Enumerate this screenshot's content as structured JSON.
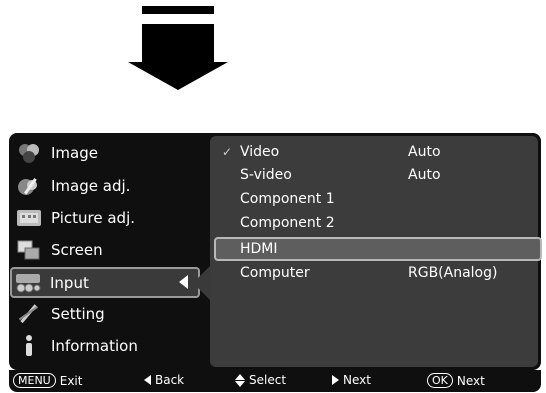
{
  "sidebar": {
    "items": [
      {
        "label": "Image",
        "icon": "image-icon"
      },
      {
        "label": "Image adj.",
        "icon": "image-adjust-icon"
      },
      {
        "label": "Picture adj.",
        "icon": "picture-adjust-icon"
      },
      {
        "label": "Screen",
        "icon": "screen-icon"
      },
      {
        "label": "Input",
        "icon": "input-icon",
        "active": true
      },
      {
        "label": "Setting",
        "icon": "setting-icon"
      },
      {
        "label": "Information",
        "icon": "information-icon"
      }
    ]
  },
  "input_menu": {
    "rows": [
      {
        "label": "Video",
        "value": "Auto",
        "checked": true
      },
      {
        "label": "S-video",
        "value": "Auto"
      },
      {
        "label": "Component 1",
        "value": ""
      },
      {
        "label": "Component 2",
        "value": ""
      },
      {
        "label": "HDMI",
        "value": "",
        "selected": true
      },
      {
        "label": "Computer",
        "value": "RGB(Analog)"
      }
    ],
    "check_mark": "✓"
  },
  "help_bar": {
    "exit_key": "MENU",
    "exit_label": "Exit",
    "back_label": "Back",
    "select_label": "Select",
    "next_label": "Next",
    "ok_key": "OK",
    "ok_label": "Next"
  }
}
